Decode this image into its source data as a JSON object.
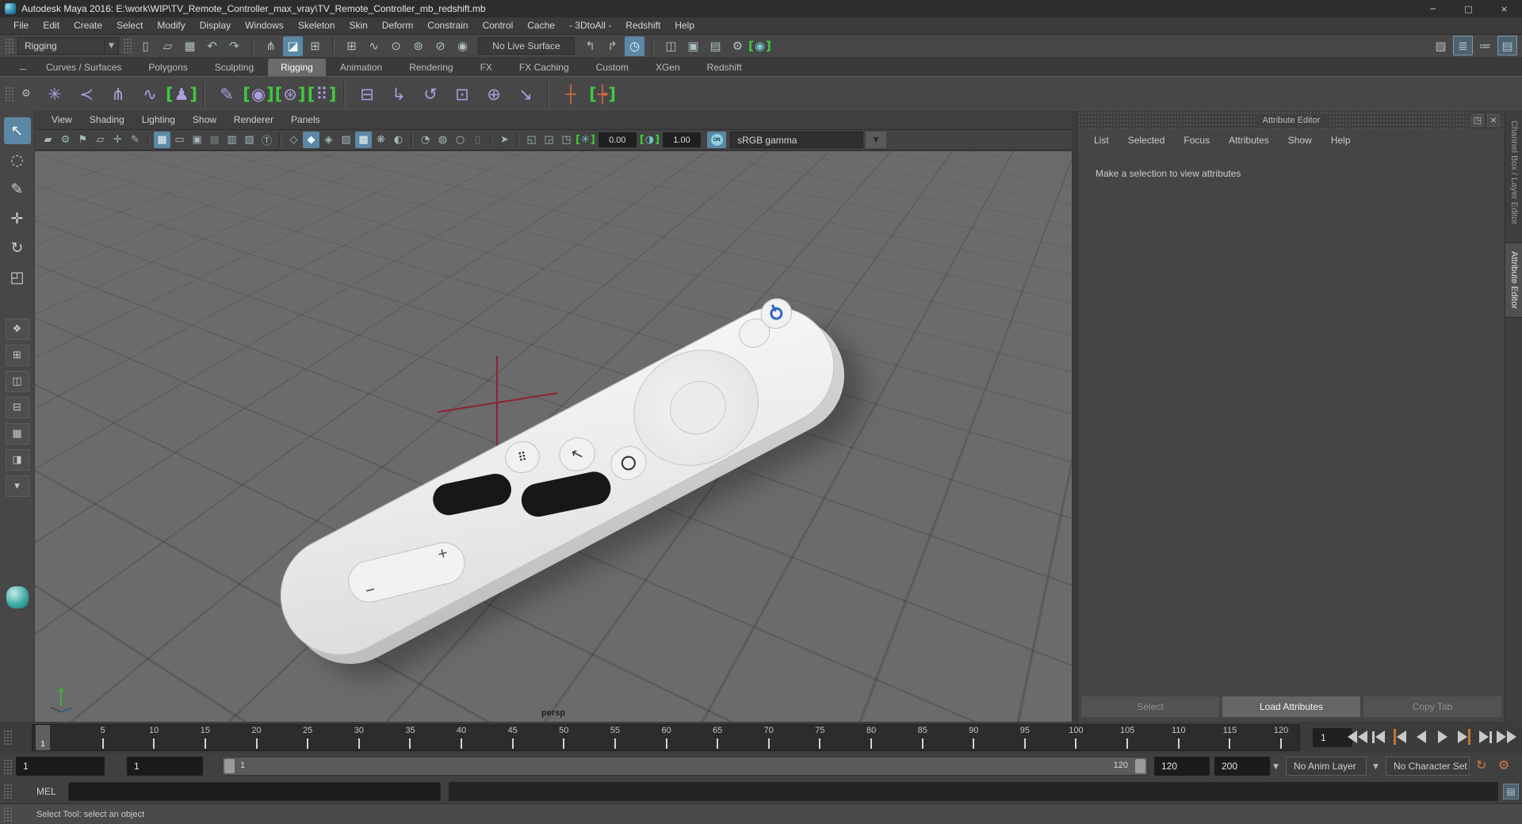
{
  "window": {
    "title": "Autodesk Maya 2016: E:\\work\\WIP\\TV_Remote_Controller_max_vray\\TV_Remote_Controller_mb_redshift.mb",
    "controls": [
      {
        "name": "minimize-button",
        "glyph": "─"
      },
      {
        "name": "maximize-button",
        "glyph": "□"
      },
      {
        "name": "close-button",
        "glyph": "×"
      }
    ]
  },
  "menu_bar": {
    "items": [
      "File",
      "Edit",
      "Create",
      "Select",
      "Modify",
      "Display",
      "Windows",
      "Skeleton",
      "Skin",
      "Deform",
      "Constrain",
      "Control",
      "Cache",
      "- 3DtoAll -",
      "Redshift",
      "Help"
    ]
  },
  "toolbar": {
    "mode_selector": {
      "value": "Rigging"
    },
    "live_surface": "No Live Surface",
    "icons_left": [
      {
        "name": "new-scene-icon",
        "glyph": "▯"
      },
      {
        "name": "open-scene-icon",
        "glyph": "▱"
      },
      {
        "name": "save-scene-icon",
        "glyph": "▦"
      },
      {
        "name": "undo-icon",
        "glyph": "↶"
      },
      {
        "name": "redo-icon",
        "glyph": "↷"
      },
      {
        "cls": "sep",
        "inter": "false"
      },
      {
        "name": "select-by-hierarchy-icon",
        "glyph": "⋔"
      },
      {
        "name": "select-by-object-icon",
        "glyph": "◪",
        "cls": "active"
      },
      {
        "name": "select-by-component-icon",
        "glyph": "⊞"
      },
      {
        "cls": "sep",
        "inter": "false"
      },
      {
        "name": "snap-to-grid-icon",
        "glyph": "⊞"
      },
      {
        "name": "snap-to-curve-icon",
        "glyph": "∿"
      },
      {
        "name": "snap-to-point-icon",
        "glyph": "⊙"
      },
      {
        "name": "snap-to-projected-center-icon",
        "glyph": "⊚"
      },
      {
        "name": "snap-to-view-plane-icon",
        "glyph": "⊘"
      },
      {
        "name": "make-live-icon",
        "glyph": "◉"
      }
    ],
    "icons_mid": [
      {
        "name": "input-connections-icon",
        "glyph": "↰"
      },
      {
        "name": "output-connections-icon",
        "glyph": "↱"
      },
      {
        "name": "construction-history-icon",
        "glyph": "◷",
        "cls": "active"
      },
      {
        "cls": "sep",
        "inter": "false"
      },
      {
        "name": "open-render-view-icon",
        "glyph": "◫"
      },
      {
        "name": "render-current-frame-icon",
        "glyph": "▣"
      },
      {
        "name": "ipr-render-icon",
        "glyph": "▤"
      },
      {
        "name": "render-settings-icon",
        "glyph": "⚙"
      },
      {
        "name": "redshift-render-icon",
        "glyph": "◉",
        "cls": "bracket teal"
      }
    ],
    "icons_right": [
      {
        "name": "modeling-toolkit-icon",
        "glyph": "▧"
      },
      {
        "name": "attribute-editor-toggle-icon",
        "glyph": "≣",
        "cls": "framed"
      },
      {
        "name": "tool-settings-toggle-icon",
        "glyph": "≔"
      },
      {
        "name": "channel-box-toggle-icon",
        "glyph": "▤",
        "cls": "framed"
      }
    ]
  },
  "shelf": {
    "tabs": [
      {
        "label": "Curves / Surfaces"
      },
      {
        "label": "Polygons"
      },
      {
        "label": "Sculpting"
      },
      {
        "label": "Rigging",
        "cls": "active"
      },
      {
        "label": "Animation"
      },
      {
        "label": "Rendering"
      },
      {
        "label": "FX"
      },
      {
        "label": "FX Caching"
      },
      {
        "label": "Custom"
      },
      {
        "label": "XGen"
      },
      {
        "label": "Redshift"
      }
    ],
    "icons": [
      {
        "name": "joint-tool-icon",
        "glyph": "✳",
        "cls": "purple"
      },
      {
        "name": "ik-handle-tool-icon",
        "glyph": "≺",
        "cls": "purple"
      },
      {
        "name": "insert-joint-tool-icon",
        "glyph": "⋔",
        "cls": "purple"
      },
      {
        "name": "ik-spline-handle-tool-icon",
        "glyph": "∿",
        "cls": "purple"
      },
      {
        "name": "humanik-character-icon",
        "glyph": "♟",
        "cls": "purple bracket"
      },
      {
        "cls": "sep",
        "inter": "false"
      },
      {
        "name": "paint-skin-weights-icon",
        "glyph": "✎",
        "cls": "purple"
      },
      {
        "name": "bind-skin-icon",
        "glyph": "◉",
        "cls": "purple bracket"
      },
      {
        "name": "smooth-bind-icon",
        "glyph": "⊛",
        "cls": "purple bracket"
      },
      {
        "name": "interactive-bind-icon",
        "glyph": "⠿",
        "cls": "purple bracket"
      },
      {
        "cls": "sep",
        "inter": "false"
      },
      {
        "name": "parent-constraint-icon",
        "glyph": "⊟",
        "cls": "purple"
      },
      {
        "name": "point-constraint-icon",
        "glyph": "↳",
        "cls": "purple"
      },
      {
        "name": "orient-constraint-icon",
        "glyph": "↺",
        "cls": "purple"
      },
      {
        "name": "scale-constraint-icon",
        "glyph": "⊡",
        "cls": "purple"
      },
      {
        "name": "aim-constraint-icon",
        "glyph": "⊕",
        "cls": "purple"
      },
      {
        "name": "pole-vector-constraint-icon",
        "glyph": "↘",
        "cls": "purple"
      },
      {
        "cls": "sep",
        "inter": "false"
      },
      {
        "name": "display-controls-icon",
        "glyph": "┼",
        "cls": "orange"
      },
      {
        "name": "edit-controls-icon",
        "glyph": "┾",
        "cls": "orange bracket"
      }
    ]
  },
  "toolbox": {
    "tools": [
      {
        "name": "select-tool",
        "glyph": "↖",
        "cls": "active"
      },
      {
        "name": "lasso-select-tool",
        "glyph": "◌"
      },
      {
        "name": "paint-select-tool",
        "glyph": "✎"
      },
      {
        "name": "move-tool",
        "glyph": "✛",
        "cls": "teal"
      },
      {
        "name": "rotate-tool",
        "glyph": "↻",
        "cls": "teal"
      },
      {
        "name": "scale-tool",
        "glyph": "◰",
        "cls": "teal"
      }
    ],
    "layouts": [
      {
        "name": "single-pane-layout-button",
        "glyph": "❖"
      },
      {
        "name": "four-view-layout-button",
        "glyph": "⊞"
      },
      {
        "name": "outliner-persp-layout-button",
        "glyph": "◫"
      },
      {
        "name": "persp-graph-layout-button",
        "glyph": "⊟"
      },
      {
        "name": "hypershade-persp-layout-button",
        "glyph": "▦"
      },
      {
        "name": "persp-outliner-graph-layout-button",
        "glyph": "◨"
      },
      {
        "name": "layout-dropdown-button",
        "glyph": "▾"
      }
    ]
  },
  "viewport": {
    "menus": [
      "View",
      "Shading",
      "Lighting",
      "Show",
      "Renderer",
      "Panels"
    ],
    "toolbar_icons": [
      {
        "name": "select-camera-icon",
        "glyph": "▰"
      },
      {
        "name": "camera-attributes-icon",
        "glyph": "⚙"
      },
      {
        "name": "bookmark-icon",
        "glyph": "⚑"
      },
      {
        "name": "image-plane-icon",
        "glyph": "▱"
      },
      {
        "name": "two-d-pan-zoom-icon",
        "glyph": "✛"
      },
      {
        "name": "grease-pencil-icon",
        "glyph": "✎"
      },
      {
        "cls": "sep",
        "inter": "false"
      },
      {
        "name": "grid-toggle-icon",
        "glyph": "▦",
        "cls": "active"
      },
      {
        "name": "film-gate-icon",
        "glyph": "▭"
      },
      {
        "name": "resolution-gate-icon",
        "glyph": "▣"
      },
      {
        "name": "gate-mask-icon",
        "glyph": "▩",
        "cls": "dim"
      },
      {
        "name": "field-chart-icon",
        "glyph": "▥"
      },
      {
        "name": "safe-action-icon",
        "glyph": "▧"
      },
      {
        "name": "safe-title-icon",
        "glyph": "Ⓣ"
      },
      {
        "cls": "sep",
        "inter": "false"
      },
      {
        "name": "wireframe-icon",
        "glyph": "◇"
      },
      {
        "name": "shaded-icon",
        "glyph": "◆",
        "cls": "active"
      },
      {
        "name": "wireframe-on-shaded-icon",
        "glyph": "◈"
      },
      {
        "name": "textured-icon",
        "glyph": "▨"
      },
      {
        "name": "use-all-lights-icon",
        "glyph": "▩",
        "cls": "active"
      },
      {
        "name": "shadows-icon",
        "glyph": "❋"
      },
      {
        "name": "screen-space-ao-icon",
        "glyph": "◐"
      },
      {
        "cls": "sep",
        "inter": "false"
      },
      {
        "name": "xray-icon",
        "glyph": "◔"
      },
      {
        "name": "xray-joints-icon",
        "glyph": "◍"
      },
      {
        "name": "xray-active-components-icon",
        "glyph": "○"
      },
      {
        "name": "plugin-shapes-icon",
        "glyph": "▯",
        "cls": "dim"
      },
      {
        "cls": "sep",
        "inter": "false"
      },
      {
        "name": "highlight-selection-icon",
        "glyph": "➤"
      },
      {
        "cls": "sep",
        "inter": "false"
      },
      {
        "name": "isolate-select-icon",
        "glyph": "◱"
      },
      {
        "name": "multi-component-icon",
        "glyph": "◲"
      },
      {
        "name": "symmetry-icon",
        "glyph": "◳"
      }
    ],
    "exposure_icon": "✳",
    "exposure_value": "0.00",
    "gamma_icon": "◑",
    "gamma_value": "1.00",
    "on_toggle": "ON",
    "view_transform": "sRGB gamma",
    "camera_label": "persp"
  },
  "attribute_editor": {
    "title": "Attribute Editor",
    "header_icons": [
      {
        "name": "float-panel-icon",
        "glyph": "◳"
      },
      {
        "name": "close-panel-icon",
        "glyph": "×"
      }
    ],
    "menus": [
      "List",
      "Selected",
      "Focus",
      "Attributes",
      "Show",
      "Help"
    ],
    "message": "Make a selection to view attributes",
    "buttons": [
      {
        "label": "Select"
      },
      {
        "label": "Load Attributes",
        "cls": "primary"
      },
      {
        "label": "Copy Tab"
      }
    ]
  },
  "side_tabs": {
    "top": "Channel Box / Layer Editor",
    "active": "Attribute Editor"
  },
  "timeline": {
    "start_cell": "1",
    "current_frame": "1",
    "ticks": [
      {
        "label": "5",
        "style": "left:4.13%"
      },
      {
        "label": "10",
        "style": "left:8.26%"
      },
      {
        "label": "15",
        "style": "left:12.4%"
      },
      {
        "label": "20",
        "style": "left:16.53%"
      },
      {
        "label": "25",
        "style": "left:20.66%"
      },
      {
        "label": "30",
        "style": "left:24.79%"
      },
      {
        "label": "35",
        "style": "left:28.93%"
      },
      {
        "label": "40",
        "style": "left:33.06%"
      },
      {
        "label": "45",
        "style": "left:37.19%"
      },
      {
        "label": "50",
        "style": "left:41.32%"
      },
      {
        "label": "55",
        "style": "left:45.45%"
      },
      {
        "label": "60",
        "style": "left:49.59%"
      },
      {
        "label": "65",
        "style": "left:53.72%"
      },
      {
        "label": "70",
        "style": "left:57.85%"
      },
      {
        "label": "75",
        "style": "left:61.98%"
      },
      {
        "label": "80",
        "style": "left:66.12%"
      },
      {
        "label": "85",
        "style": "left:70.25%"
      },
      {
        "label": "90",
        "style": "left:74.38%"
      },
      {
        "label": "95",
        "style": "left:78.51%"
      },
      {
        "label": "100",
        "style": "left:82.64%"
      },
      {
        "label": "105",
        "style": "left:86.78%"
      },
      {
        "label": "110",
        "style": "left:90.91%"
      },
      {
        "label": "115",
        "style": "left:95.04%"
      },
      {
        "label": "120",
        "style": "left:99.17%"
      }
    ]
  },
  "range_slider": {
    "animation_start": "1",
    "playback_start": "1",
    "slider_start_label": "1",
    "slider_end_label": "120",
    "playback_end": "120",
    "animation_end": "200",
    "anim_layer": "No Anim Layer",
    "character_set": "No Character Set"
  },
  "command_line": {
    "label": "MEL"
  },
  "help_line": {
    "text": "Select Tool: select an object"
  },
  "colors": {
    "accent_blue": "#5b88a5",
    "viewport_bg": "#6b6b6b",
    "origin_red": "#8d2133",
    "key_orange": "#c7762e",
    "bracket_green": "#3ecb3e",
    "shelf_purple": "#ab9fdd"
  }
}
